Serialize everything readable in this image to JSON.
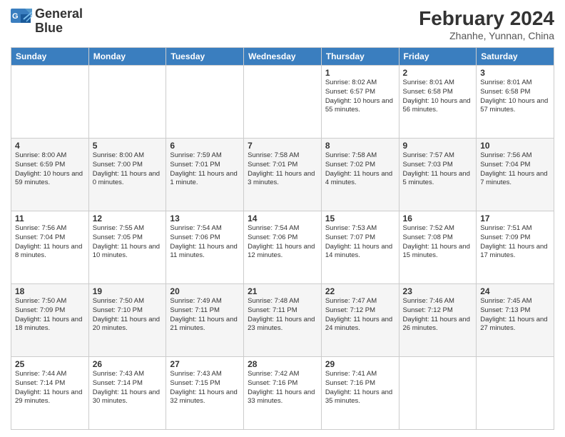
{
  "header": {
    "logo_line1": "General",
    "logo_line2": "Blue",
    "month": "February 2024",
    "location": "Zhanhe, Yunnan, China"
  },
  "days_of_week": [
    "Sunday",
    "Monday",
    "Tuesday",
    "Wednesday",
    "Thursday",
    "Friday",
    "Saturday"
  ],
  "weeks": [
    [
      {
        "day": "",
        "info": ""
      },
      {
        "day": "",
        "info": ""
      },
      {
        "day": "",
        "info": ""
      },
      {
        "day": "",
        "info": ""
      },
      {
        "day": "1",
        "info": "Sunrise: 8:02 AM\nSunset: 6:57 PM\nDaylight: 10 hours and 55 minutes."
      },
      {
        "day": "2",
        "info": "Sunrise: 8:01 AM\nSunset: 6:58 PM\nDaylight: 10 hours and 56 minutes."
      },
      {
        "day": "3",
        "info": "Sunrise: 8:01 AM\nSunset: 6:58 PM\nDaylight: 10 hours and 57 minutes."
      }
    ],
    [
      {
        "day": "4",
        "info": "Sunrise: 8:00 AM\nSunset: 6:59 PM\nDaylight: 10 hours and 59 minutes."
      },
      {
        "day": "5",
        "info": "Sunrise: 8:00 AM\nSunset: 7:00 PM\nDaylight: 11 hours and 0 minutes."
      },
      {
        "day": "6",
        "info": "Sunrise: 7:59 AM\nSunset: 7:01 PM\nDaylight: 11 hours and 1 minute."
      },
      {
        "day": "7",
        "info": "Sunrise: 7:58 AM\nSunset: 7:01 PM\nDaylight: 11 hours and 3 minutes."
      },
      {
        "day": "8",
        "info": "Sunrise: 7:58 AM\nSunset: 7:02 PM\nDaylight: 11 hours and 4 minutes."
      },
      {
        "day": "9",
        "info": "Sunrise: 7:57 AM\nSunset: 7:03 PM\nDaylight: 11 hours and 5 minutes."
      },
      {
        "day": "10",
        "info": "Sunrise: 7:56 AM\nSunset: 7:04 PM\nDaylight: 11 hours and 7 minutes."
      }
    ],
    [
      {
        "day": "11",
        "info": "Sunrise: 7:56 AM\nSunset: 7:04 PM\nDaylight: 11 hours and 8 minutes."
      },
      {
        "day": "12",
        "info": "Sunrise: 7:55 AM\nSunset: 7:05 PM\nDaylight: 11 hours and 10 minutes."
      },
      {
        "day": "13",
        "info": "Sunrise: 7:54 AM\nSunset: 7:06 PM\nDaylight: 11 hours and 11 minutes."
      },
      {
        "day": "14",
        "info": "Sunrise: 7:54 AM\nSunset: 7:06 PM\nDaylight: 11 hours and 12 minutes."
      },
      {
        "day": "15",
        "info": "Sunrise: 7:53 AM\nSunset: 7:07 PM\nDaylight: 11 hours and 14 minutes."
      },
      {
        "day": "16",
        "info": "Sunrise: 7:52 AM\nSunset: 7:08 PM\nDaylight: 11 hours and 15 minutes."
      },
      {
        "day": "17",
        "info": "Sunrise: 7:51 AM\nSunset: 7:09 PM\nDaylight: 11 hours and 17 minutes."
      }
    ],
    [
      {
        "day": "18",
        "info": "Sunrise: 7:50 AM\nSunset: 7:09 PM\nDaylight: 11 hours and 18 minutes."
      },
      {
        "day": "19",
        "info": "Sunrise: 7:50 AM\nSunset: 7:10 PM\nDaylight: 11 hours and 20 minutes."
      },
      {
        "day": "20",
        "info": "Sunrise: 7:49 AM\nSunset: 7:11 PM\nDaylight: 11 hours and 21 minutes."
      },
      {
        "day": "21",
        "info": "Sunrise: 7:48 AM\nSunset: 7:11 PM\nDaylight: 11 hours and 23 minutes."
      },
      {
        "day": "22",
        "info": "Sunrise: 7:47 AM\nSunset: 7:12 PM\nDaylight: 11 hours and 24 minutes."
      },
      {
        "day": "23",
        "info": "Sunrise: 7:46 AM\nSunset: 7:12 PM\nDaylight: 11 hours and 26 minutes."
      },
      {
        "day": "24",
        "info": "Sunrise: 7:45 AM\nSunset: 7:13 PM\nDaylight: 11 hours and 27 minutes."
      }
    ],
    [
      {
        "day": "25",
        "info": "Sunrise: 7:44 AM\nSunset: 7:14 PM\nDaylight: 11 hours and 29 minutes."
      },
      {
        "day": "26",
        "info": "Sunrise: 7:43 AM\nSunset: 7:14 PM\nDaylight: 11 hours and 30 minutes."
      },
      {
        "day": "27",
        "info": "Sunrise: 7:43 AM\nSunset: 7:15 PM\nDaylight: 11 hours and 32 minutes."
      },
      {
        "day": "28",
        "info": "Sunrise: 7:42 AM\nSunset: 7:16 PM\nDaylight: 11 hours and 33 minutes."
      },
      {
        "day": "29",
        "info": "Sunrise: 7:41 AM\nSunset: 7:16 PM\nDaylight: 11 hours and 35 minutes."
      },
      {
        "day": "",
        "info": ""
      },
      {
        "day": "",
        "info": ""
      }
    ]
  ]
}
